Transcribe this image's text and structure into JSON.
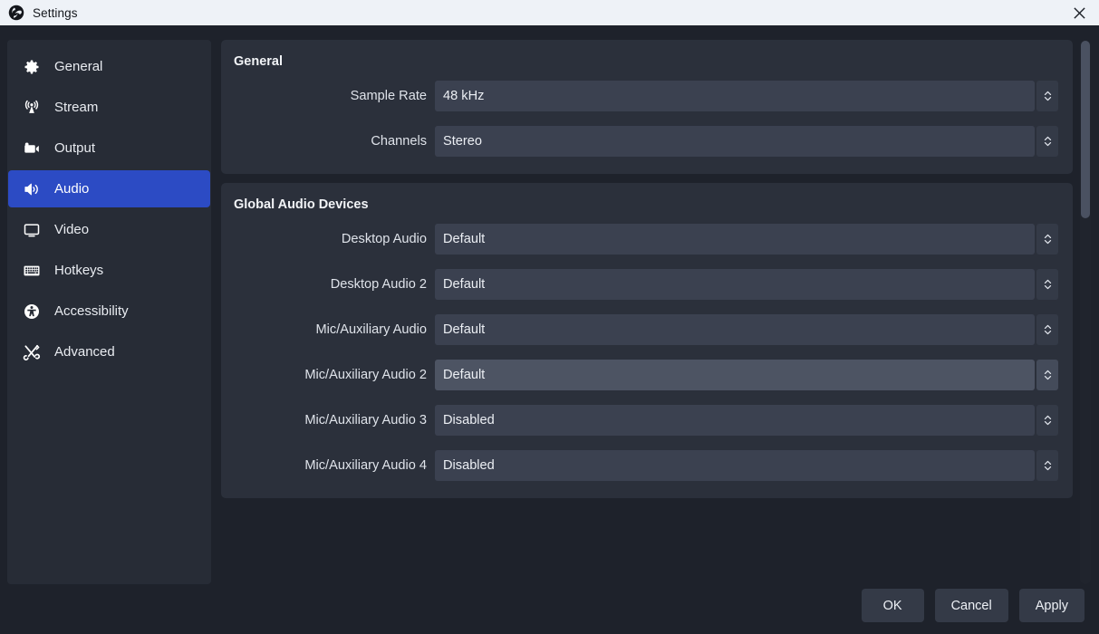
{
  "titlebar": {
    "title": "Settings",
    "logo_icon": "obs-logo-icon",
    "close_icon": "close-icon"
  },
  "sidebar": {
    "items": [
      {
        "label": "General",
        "icon": "gear-icon",
        "active": false
      },
      {
        "label": "Stream",
        "icon": "broadcast-icon",
        "active": false
      },
      {
        "label": "Output",
        "icon": "video-camera-icon",
        "active": false
      },
      {
        "label": "Audio",
        "icon": "speaker-icon",
        "active": true
      },
      {
        "label": "Video",
        "icon": "monitor-icon",
        "active": false
      },
      {
        "label": "Hotkeys",
        "icon": "keyboard-icon",
        "active": false
      },
      {
        "label": "Accessibility",
        "icon": "accessibility-icon",
        "active": false
      },
      {
        "label": "Advanced",
        "icon": "tools-icon",
        "active": false
      }
    ]
  },
  "main": {
    "groups": [
      {
        "title": "General",
        "fields": [
          {
            "label": "Sample Rate",
            "value": "48 kHz",
            "hovered": false
          },
          {
            "label": "Channels",
            "value": "Stereo",
            "hovered": false
          }
        ]
      },
      {
        "title": "Global Audio Devices",
        "fields": [
          {
            "label": "Desktop Audio",
            "value": "Default",
            "hovered": false
          },
          {
            "label": "Desktop Audio 2",
            "value": "Default",
            "hovered": false
          },
          {
            "label": "Mic/Auxiliary Audio",
            "value": "Default",
            "hovered": false
          },
          {
            "label": "Mic/Auxiliary Audio 2",
            "value": "Default",
            "hovered": true
          },
          {
            "label": "Mic/Auxiliary Audio 3",
            "value": "Disabled",
            "hovered": false
          },
          {
            "label": "Mic/Auxiliary Audio 4",
            "value": "Disabled",
            "hovered": false
          }
        ]
      }
    ]
  },
  "footer": {
    "buttons": [
      {
        "label": "OK"
      },
      {
        "label": "Cancel"
      },
      {
        "label": "Apply"
      }
    ]
  },
  "colors": {
    "accent": "#2c4bc4",
    "titlebar_bg": "#eef2f7",
    "window_bg": "#1e222b",
    "sidebar_bg": "#272c36",
    "group_bg": "#2b303b",
    "field_bg": "#3b4150",
    "field_hover_bg": "#4d5463"
  }
}
